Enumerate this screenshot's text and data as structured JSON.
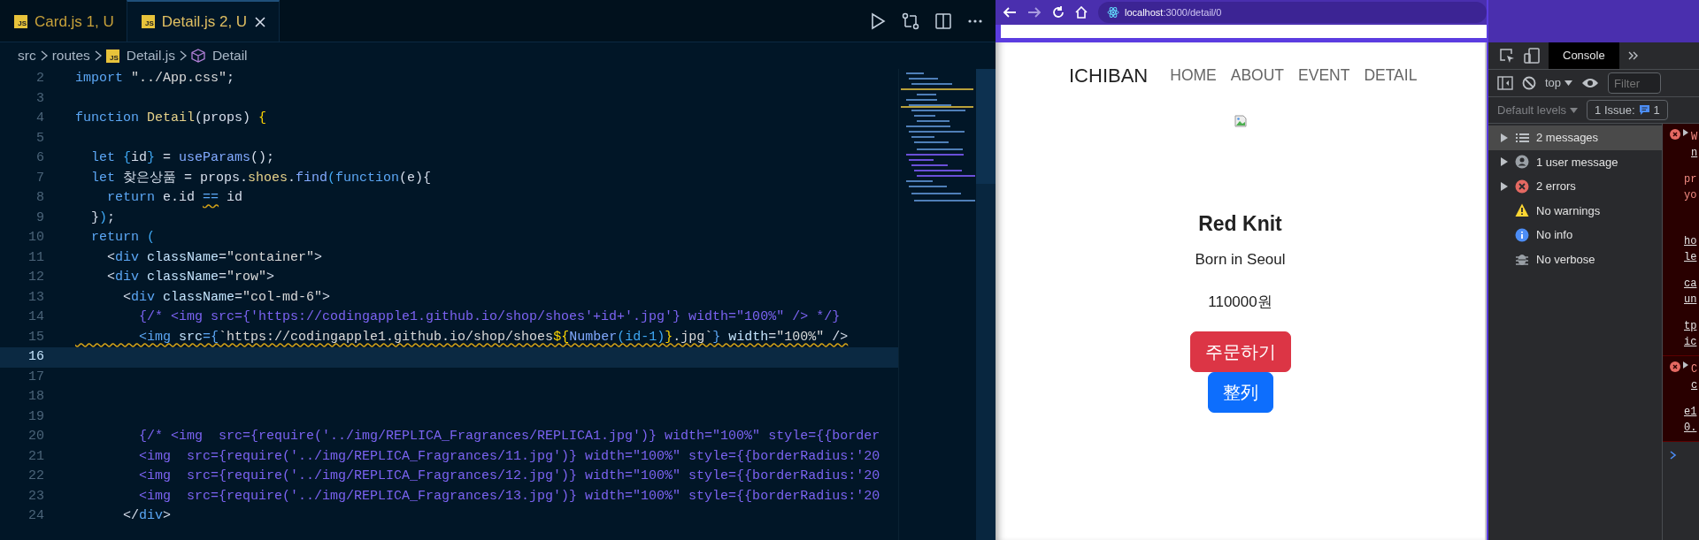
{
  "editor": {
    "tabs": [
      {
        "icon_text": "JS",
        "label": "Card.js",
        "badge": "1, U",
        "selected": false
      },
      {
        "icon_text": "JS",
        "label": "Detail.js",
        "badge": "2, U",
        "selected": true
      }
    ],
    "breadcrumb": [
      {
        "label": "src",
        "kind": "folder"
      },
      {
        "label": "routes",
        "kind": "folder"
      },
      {
        "label": "Detail.js",
        "kind": "file",
        "icon_text": "JS"
      },
      {
        "label": "Detail",
        "kind": "symbol"
      }
    ],
    "lines": [
      {
        "number": "2",
        "current": false,
        "segments": [
          {
            "text": "import",
            "kind": "keyword"
          },
          {
            "text": " \"../App.css\"",
            "kind": "string"
          },
          {
            "text": ";",
            "kind": "plain"
          }
        ]
      },
      {
        "number": "3",
        "current": false
      },
      {
        "number": "4",
        "current": false,
        "segments": [
          {
            "text": "function",
            "kind": "keyword"
          },
          {
            "text": " Detail",
            "kind": "name"
          },
          {
            "text": "(props) ",
            "kind": "plain"
          },
          {
            "text": "{",
            "kind": "brace"
          }
        ]
      },
      {
        "number": "5",
        "current": false
      },
      {
        "number": "6",
        "current": false,
        "segments": [
          {
            "text": "  let ",
            "kind": "keyword"
          },
          {
            "text": "{",
            "kind": "paren"
          },
          {
            "text": "id",
            "kind": "plain"
          },
          {
            "text": "}",
            "kind": "paren"
          },
          {
            "text": " = ",
            "kind": "plain"
          },
          {
            "text": "useParams",
            "kind": "func"
          },
          {
            "text": "();",
            "kind": "plain"
          }
        ]
      },
      {
        "number": "7",
        "current": false,
        "segments": [
          {
            "text": "  let ",
            "kind": "keyword"
          },
          {
            "text": "찾은상품 = props.",
            "kind": "plain"
          },
          {
            "text": "shoes",
            "kind": "name"
          },
          {
            "text": ".",
            "kind": "plain"
          },
          {
            "text": "find",
            "kind": "func"
          },
          {
            "text": "(",
            "kind": "paren"
          },
          {
            "text": "function",
            "kind": "keyword"
          },
          {
            "text": "(e){",
            "kind": "plain"
          }
        ]
      },
      {
        "number": "8",
        "current": false,
        "segments": [
          {
            "text": "    return ",
            "kind": "keyword"
          },
          {
            "text": "e.id ",
            "kind": "plain"
          },
          {
            "text": "==",
            "kind": "keyword",
            "warning": true
          },
          {
            "text": " id",
            "kind": "plain"
          }
        ]
      },
      {
        "number": "9",
        "current": false,
        "segments": [
          {
            "text": "  }",
            "kind": "plain"
          },
          {
            "text": ")",
            "kind": "paren"
          },
          {
            "text": ";",
            "kind": "plain"
          }
        ]
      },
      {
        "number": "10",
        "current": false,
        "segments": [
          {
            "text": "  return ",
            "kind": "keyword"
          },
          {
            "text": "(",
            "kind": "paren"
          }
        ]
      },
      {
        "number": "11",
        "current": false,
        "segments": [
          {
            "text": "    <",
            "kind": "plain"
          },
          {
            "text": "div",
            "kind": "tag"
          },
          {
            "text": " className",
            "kind": "attr"
          },
          {
            "text": "=",
            "kind": "plain"
          },
          {
            "text": "\"container\"",
            "kind": "string"
          },
          {
            "text": ">",
            "kind": "plain"
          }
        ]
      },
      {
        "number": "12",
        "current": false,
        "segments": [
          {
            "text": "    <",
            "kind": "plain"
          },
          {
            "text": "div",
            "kind": "tag"
          },
          {
            "text": " className",
            "kind": "attr"
          },
          {
            "text": "=",
            "kind": "plain"
          },
          {
            "text": "\"row\"",
            "kind": "string"
          },
          {
            "text": ">",
            "kind": "plain"
          }
        ]
      },
      {
        "number": "13",
        "current": false,
        "segments": [
          {
            "text": "      <",
            "kind": "plain"
          },
          {
            "text": "div",
            "kind": "tag"
          },
          {
            "text": " className",
            "kind": "attr"
          },
          {
            "text": "=",
            "kind": "plain"
          },
          {
            "text": "\"col-md-6\"",
            "kind": "string"
          },
          {
            "text": ">",
            "kind": "plain"
          }
        ]
      },
      {
        "number": "14",
        "current": false,
        "segments": [
          {
            "text": "        {/* <img src={'https://codingapple1.github.io/shop/shoes'+id+'.jpg'} width=\"100%\" /> */}",
            "kind": "comment"
          }
        ]
      },
      {
        "number": "15",
        "current": false,
        "segments": [
          {
            "text": "        <img",
            "kind": "tag",
            "warning": true
          },
          {
            "text": " src",
            "kind": "attr",
            "warning": true
          },
          {
            "text": "={",
            "kind": "tag",
            "warning": true
          },
          {
            "text": "`https://codingapple1.github.io/shop/shoes",
            "kind": "string",
            "warning": true
          },
          {
            "text": "${",
            "kind": "brace",
            "warning": true
          },
          {
            "text": "Number",
            "kind": "func",
            "warning": true
          },
          {
            "text": "(id-1)",
            "kind": "paren",
            "warning": true
          },
          {
            "text": "}",
            "kind": "brace",
            "warning": true
          },
          {
            "text": ".jpg`",
            "kind": "string",
            "warning": true
          },
          {
            "text": "}",
            "kind": "tag",
            "warning": true
          },
          {
            "text": " width",
            "kind": "attr",
            "warning": true
          },
          {
            "text": "=",
            "kind": "plain",
            "warning": true
          },
          {
            "text": "\"100%\"",
            "kind": "string",
            "warning": true
          },
          {
            "text": " />",
            "kind": "plain",
            "warning": true
          }
        ]
      },
      {
        "number": "16",
        "current": true
      },
      {
        "number": "17",
        "current": false
      },
      {
        "number": "18",
        "current": false
      },
      {
        "number": "19",
        "current": false
      },
      {
        "number": "20",
        "current": false,
        "segments": [
          {
            "text": "        {/* <img  src={require('../img/REPLICA_Fragrances/REPLICA1.jpg')} width=\"100%\" style={{border",
            "kind": "comment"
          }
        ]
      },
      {
        "number": "21",
        "current": false,
        "segments": [
          {
            "text": "        <img  src={require('../img/REPLICA_Fragrances/11.jpg')} width=\"100%\" style={{borderRadius:'20",
            "kind": "comment"
          }
        ]
      },
      {
        "number": "22",
        "current": false,
        "segments": [
          {
            "text": "        <img  src={require('../img/REPLICA_Fragrances/12.jpg')} width=\"100%\" style={{borderRadius:'20",
            "kind": "comment"
          }
        ]
      },
      {
        "number": "23",
        "current": false,
        "segments": [
          {
            "text": "        <img  src={require('../img/REPLICA_Fragrances/13.jpg')} width=\"100%\" style={{borderRadius:'20",
            "kind": "comment"
          }
        ]
      },
      {
        "number": "24",
        "current": false,
        "segments": [
          {
            "text": "      </",
            "kind": "plain"
          },
          {
            "text": "div",
            "kind": "tag"
          },
          {
            "text": ">",
            "kind": "plain"
          }
        ]
      }
    ]
  },
  "browser": {
    "address_host": "localhost",
    "address_path": ":3000/detail/0",
    "page": {
      "brand": "ICHIBAN",
      "nav": [
        "HOME",
        "ABOUT",
        "EVENT",
        "DETAIL"
      ],
      "title": "Red Knit",
      "subtitle": "Born in Seoul",
      "price": "110000원",
      "buttons": [
        {
          "label": "주문하기",
          "kind": "danger"
        },
        {
          "label": "整列",
          "kind": "primary"
        }
      ]
    }
  },
  "devtools": {
    "tabs": [
      {
        "label": "Console",
        "selected": true
      }
    ],
    "context": "top",
    "filter": {
      "placeholder": "Filter"
    },
    "levels": "Default levels",
    "issues": {
      "label": "1 Issue:",
      "count": "1"
    },
    "sidebar": [
      {
        "label": "2 messages",
        "kind": "messages",
        "expandable": true,
        "selected": true
      },
      {
        "label": "1 user message",
        "kind": "user",
        "expandable": true,
        "selected": false
      },
      {
        "label": "2 errors",
        "kind": "error",
        "expandable": true,
        "selected": false
      },
      {
        "label": "No warnings",
        "kind": "warning",
        "expandable": false,
        "selected": false
      },
      {
        "label": "No info",
        "kind": "info",
        "expandable": false,
        "selected": false
      },
      {
        "label": "No verbose",
        "kind": "verbose",
        "expandable": false,
        "selected": false
      }
    ],
    "console": [
      {
        "kind": "error",
        "blocks": [
          [
            {
              "text": "W",
              "kind": "message"
            },
            {
              "text": "n",
              "kind": "link"
            }
          ],
          [
            {
              "text": "pr",
              "kind": "message"
            },
            {
              "text": "yo",
              "kind": "message"
            }
          ],
          [
            {
              "text": "ho",
              "kind": "link"
            },
            {
              "text": "le",
              "kind": "link"
            }
          ],
          [
            {
              "text": "ca",
              "kind": "link"
            },
            {
              "text": "un",
              "kind": "link"
            }
          ],
          [
            {
              "text": "tp",
              "kind": "link"
            },
            {
              "text": "ic",
              "kind": "link"
            }
          ]
        ]
      },
      {
        "kind": "error",
        "blocks": [
          [
            {
              "text": "C",
              "kind": "message"
            },
            {
              "text": "c",
              "kind": "link"
            }
          ],
          [
            {
              "text": "e1",
              "kind": "link"
            },
            {
              "text": "0.",
              "kind": "link"
            }
          ]
        ]
      }
    ]
  }
}
